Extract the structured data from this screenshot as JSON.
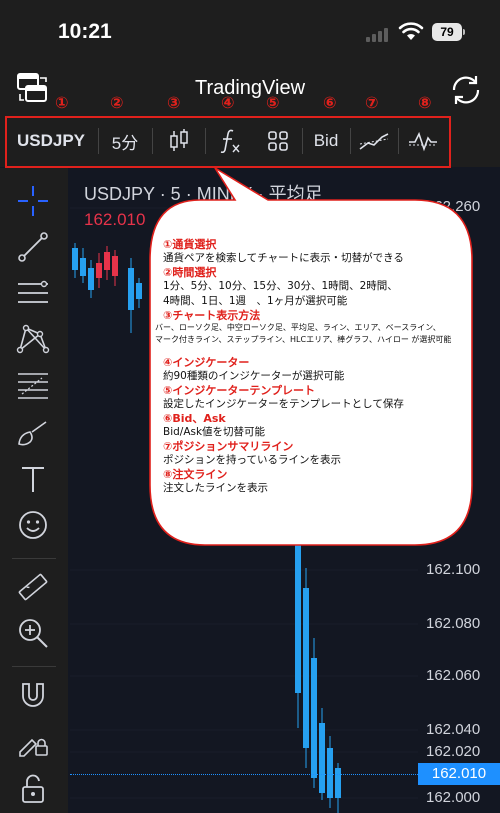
{
  "status_bar": {
    "time": "10:21",
    "battery": "79"
  },
  "header": {
    "title": "TradingView"
  },
  "annotations": {
    "numbers": [
      "①",
      "②",
      "③",
      "④",
      "⑤",
      "⑥",
      "⑦",
      "⑧"
    ]
  },
  "toolbar": {
    "symbol": "USDJPY",
    "interval": "5分",
    "price_side": "Bid"
  },
  "chart": {
    "title": "USDJPY · 5 · MINFX · 平均足",
    "last_price": "162.010",
    "price_levels": [
      "162.260",
      "162.100",
      "162.080",
      "162.060",
      "162.040",
      "162.020",
      "162.000"
    ],
    "current_price_label": "162.010",
    "colors": {
      "up": "#26a0f0",
      "down": "#e6334a",
      "accent": "#1e90ff"
    }
  },
  "callout": {
    "items": [
      {
        "heading": "①通貨選択",
        "lines": [
          "通貨ペアを検索してチャートに表示・切替ができる"
        ]
      },
      {
        "heading": "②時間選択",
        "lines": [
          "1分、5分、10分、15分、30分、1時間、2時間、",
          "4時間、1日、1週　、1ヶ月が選択可能"
        ]
      },
      {
        "heading": "③チャート表示方法",
        "small": [
          "バー、ローソク足、中空ローソク足、平均足、ライン、エリア、ベースライン、",
          "マーク付きライン、ステップライン、HLCエリア、棒グラフ、ハイロー が選択可能"
        ]
      },
      {
        "heading": "④インジケーター",
        "lines": [
          "約90種類のインジケーターが選択可能"
        ]
      },
      {
        "heading": "⑤インジケーターテンプレート",
        "lines": [
          "設定したインジケーターをテンプレートとして保存"
        ]
      },
      {
        "heading": "⑥Bid、Ask",
        "lines": [
          "Bid/Ask値を切替可能"
        ]
      },
      {
        "heading": "⑦ポジションサマリライン",
        "lines": [
          "ポジションを持っているラインを表示"
        ]
      },
      {
        "heading": "⑧注文ライン",
        "lines": [
          "注文したラインを表示"
        ]
      }
    ]
  }
}
